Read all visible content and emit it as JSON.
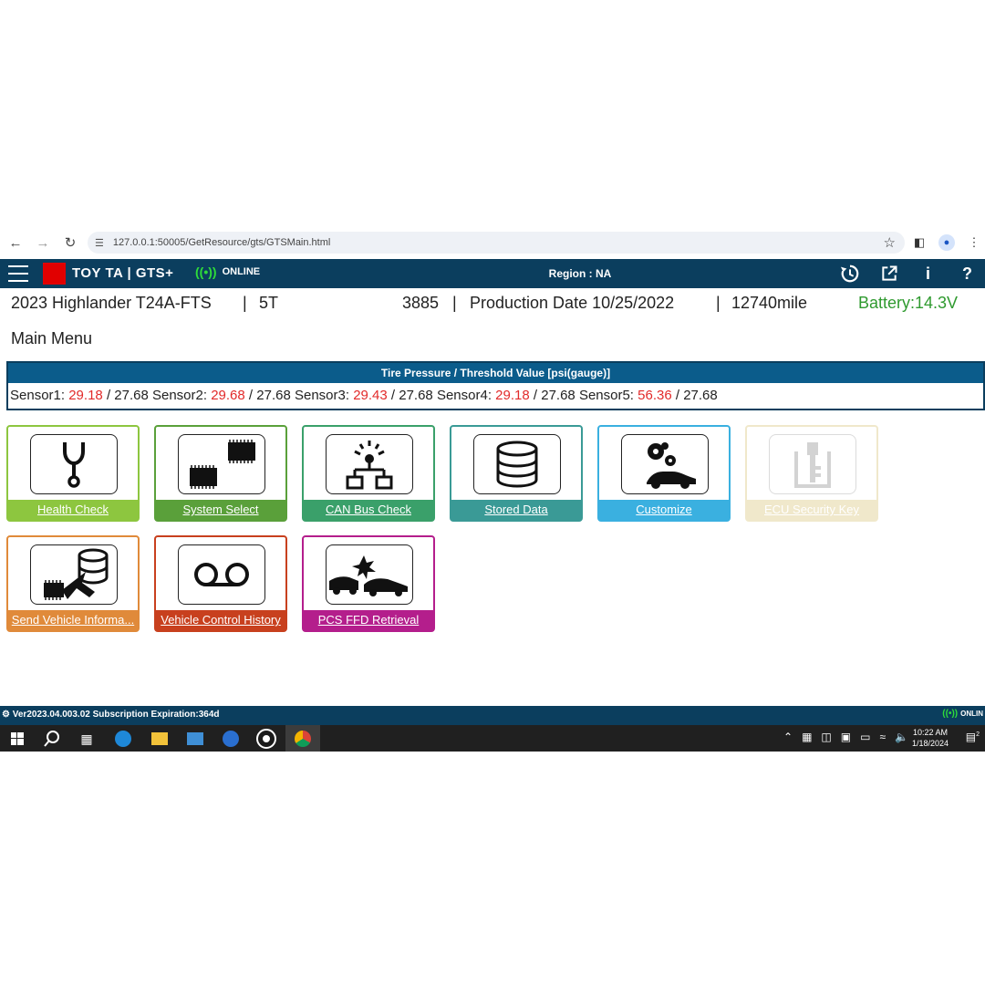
{
  "browser": {
    "url": "127.0.0.1:50005/GetResource/gts/GTSMain.html"
  },
  "header": {
    "brand": "TOY  TA | GTS+",
    "online_label": "ONLINE",
    "region": "Region : NA"
  },
  "vehicle": {
    "model": "2023 Highlander T24A-FTS",
    "sep1": "|",
    "engine": "5T",
    "code": "3885",
    "sep2": "|",
    "production": "Production Date 10/25/2022",
    "sep3": "|",
    "mileage": "12740mile",
    "battery": "Battery:14.3V"
  },
  "main_menu_title": "Main Menu",
  "tire": {
    "title": "Tire Pressure / Threshold Value [psi(gauge)]",
    "sensors": [
      {
        "label": "Sensor1:",
        "value": "29.18",
        "threshold": "/ 27.68"
      },
      {
        "label": "Sensor2:",
        "value": "29.68",
        "threshold": "/ 27.68"
      },
      {
        "label": "Sensor3:",
        "value": "29.43",
        "threshold": "/ 27.68"
      },
      {
        "label": "Sensor4:",
        "value": "29.18",
        "threshold": "/ 27.68"
      },
      {
        "label": "Sensor5:",
        "value": "56.36",
        "threshold": "/ 27.68"
      }
    ]
  },
  "tiles": [
    {
      "label": "Health Check",
      "color": "#8dc63f"
    },
    {
      "label": "System Select",
      "color": "#5aa03a"
    },
    {
      "label": "CAN Bus Check",
      "color": "#3aa06a"
    },
    {
      "label": "Stored Data",
      "color": "#3a9a96"
    },
    {
      "label": "Customize",
      "color": "#3ab0e0"
    },
    {
      "label": "ECU Security Key",
      "color": "#efe6c6"
    },
    {
      "label": "Send Vehicle Informa...",
      "color": "#e08a3a"
    },
    {
      "label": "Vehicle Control History",
      "color": "#c8401e"
    },
    {
      "label": "PCS FFD Retrieval",
      "color": "#b41e8c"
    }
  ],
  "status_bar": {
    "version": "Ver2023.04.003.02  Subscription Expiration:364d",
    "online": "ONLIN"
  },
  "taskbar": {
    "time": "10:22 AM",
    "date": "1/18/2024",
    "notifications": "2"
  },
  "icons": [
    "menu-icon",
    "history-icon",
    "external-link-icon",
    "info-icon",
    "help-icon",
    "stethoscope-icon",
    "ecu-chips-icon",
    "can-network-icon",
    "database-icon",
    "gears-car-icon",
    "key-icon",
    "ecu-send-icon",
    "recorder-icon",
    "collision-icon"
  ]
}
